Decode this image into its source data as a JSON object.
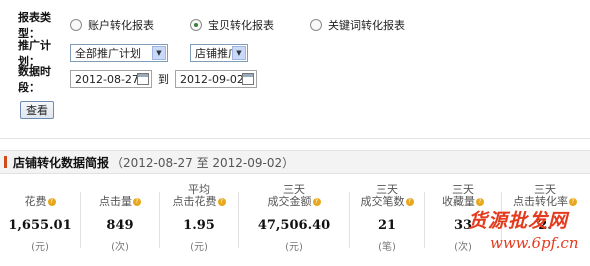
{
  "form": {
    "report_type": {
      "label": "报表类型：",
      "options": [
        {
          "label": "账户转化报表",
          "selected": false
        },
        {
          "label": "宝贝转化报表",
          "selected": true
        },
        {
          "label": "关键词转化报表",
          "selected": false
        }
      ]
    },
    "campaign": {
      "label": "推广计划：",
      "selected": "全部推广计划",
      "secondary_selected": "店铺推广"
    },
    "period": {
      "label": "数据时段：",
      "start": "2012-08-27",
      "to": "到",
      "end": "2012-09-02"
    },
    "query_button": "查看"
  },
  "summary": {
    "title": "店铺转化数据简报",
    "range": "（2012-08-27 至 2012-09-02）",
    "metrics": [
      {
        "label_lines": [
          "花费"
        ],
        "value": "1,655.01",
        "unit": "(元)"
      },
      {
        "label_lines": [
          "点击量"
        ],
        "value": "849",
        "unit": "(次)"
      },
      {
        "label_lines": [
          "平均",
          "点击花费"
        ],
        "value": "1.95",
        "unit": "(元)"
      },
      {
        "label_lines": [
          "三天",
          "成交金额"
        ],
        "value": "47,506.40",
        "unit": "(元)"
      },
      {
        "label_lines": [
          "三天",
          "成交笔数"
        ],
        "value": "21",
        "unit": "(笔)"
      },
      {
        "label_lines": [
          "三天",
          "收藏量"
        ],
        "value": "33",
        "unit": "(次)"
      },
      {
        "label_lines": [
          "三天",
          "点击转化率"
        ],
        "value": "2.",
        "unit": ""
      }
    ]
  },
  "watermark": {
    "text": "货源批发网",
    "url": "www.6pf.cn"
  },
  "colors": {
    "accent": "#d04a1a",
    "help_icon": "#e8a81d",
    "watermark": "#e43b1e"
  }
}
